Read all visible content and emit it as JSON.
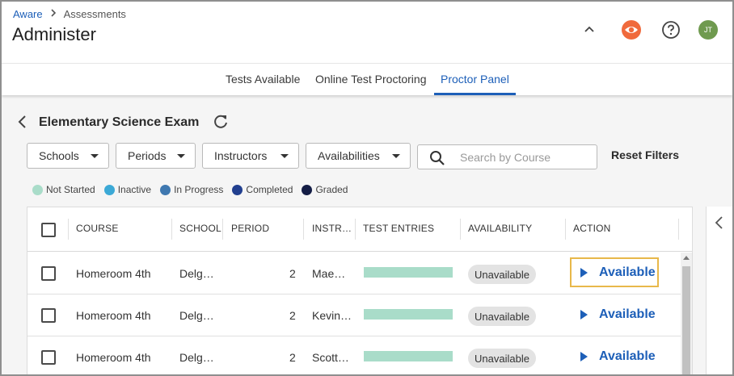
{
  "breadcrumb": {
    "root": "Aware",
    "separator": ">",
    "current": "Assessments"
  },
  "page": {
    "title": "Administer"
  },
  "header": {
    "avatar_initials": "JT"
  },
  "tabs": [
    {
      "label": "Tests Available",
      "active": false
    },
    {
      "label": "Online Test Proctoring",
      "active": false
    },
    {
      "label": "Proctor Panel",
      "active": true
    }
  ],
  "exam": {
    "title": "Elementary Science Exam"
  },
  "filters": {
    "schools": "Schools",
    "periods": "Periods",
    "instructors": "Instructors",
    "availabilities": "Availabilities",
    "search_placeholder": "Search by Course",
    "reset": "Reset Filters"
  },
  "legend": [
    {
      "label": "Not Started",
      "color": "#a9dcc9"
    },
    {
      "label": "Inactive",
      "color": "#3ca9d6"
    },
    {
      "label": "In Progress",
      "color": "#3f78b0"
    },
    {
      "label": "Completed",
      "color": "#213f8f"
    },
    {
      "label": "Graded",
      "color": "#141d45"
    }
  ],
  "table": {
    "headers": {
      "course": "COURSE",
      "school": "SCHOOL",
      "period": "PERIOD",
      "instructor": "INSTR…",
      "entries": "TEST ENTRIES",
      "availability": "AVAILABILITY",
      "action": "ACTION"
    },
    "rows": [
      {
        "course": "Homeroom 4th",
        "school": "Delg…",
        "period": "2",
        "instructor": "Mae…",
        "entries_status": "Not Started",
        "availability": "Unavailable",
        "action": "Available"
      },
      {
        "course": "Homeroom 4th",
        "school": "Delg…",
        "period": "2",
        "instructor": "Kevin…",
        "entries_status": "Not Started",
        "availability": "Unavailable",
        "action": "Available"
      },
      {
        "course": "Homeroom 4th",
        "school": "Delg…",
        "period": "2",
        "instructor": "Scott…",
        "entries_status": "Not Started",
        "availability": "Unavailable",
        "action": "Available"
      }
    ]
  },
  "colors": {
    "accent": "#1d5fb8",
    "focus_outline": "#e8b84a",
    "eye_icon": "#f06a3c",
    "avatar": "#6f9a4f"
  }
}
